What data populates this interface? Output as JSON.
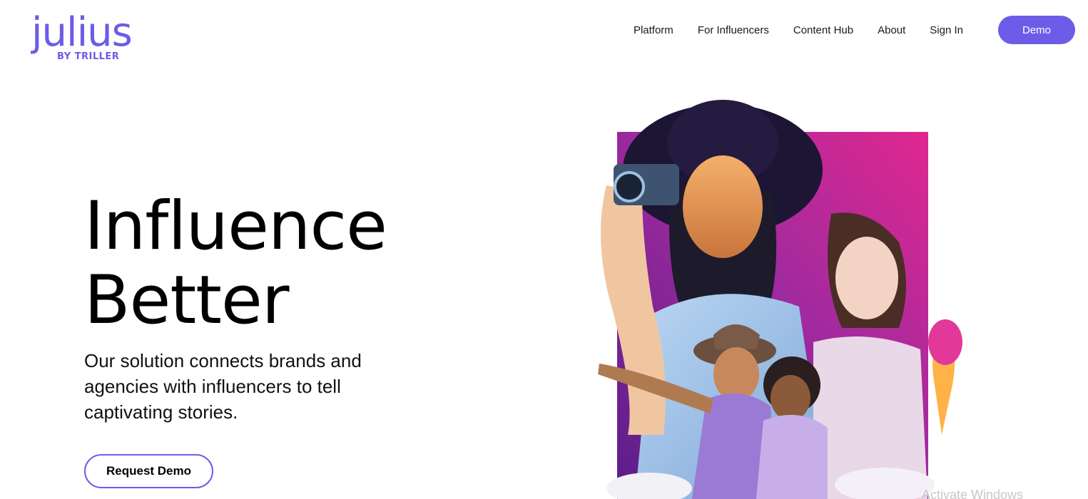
{
  "logo": {
    "word": "julius",
    "sub": "BY TRILLER"
  },
  "nav": {
    "items": [
      "Platform",
      "For Influencers",
      "Content Hub",
      "About",
      "Sign In"
    ],
    "demo_label": "Demo"
  },
  "hero": {
    "title_line1": "Influence",
    "title_line2": "Better",
    "subtitle": "Our solution connects brands and agencies with influencers to tell captivating stories.",
    "cta_label": "Request Demo"
  },
  "watermark": "Activate Windows",
  "colors": {
    "accent": "#6c5ce7",
    "magenta": "#d6279a",
    "purple": "#7a2a9c"
  }
}
